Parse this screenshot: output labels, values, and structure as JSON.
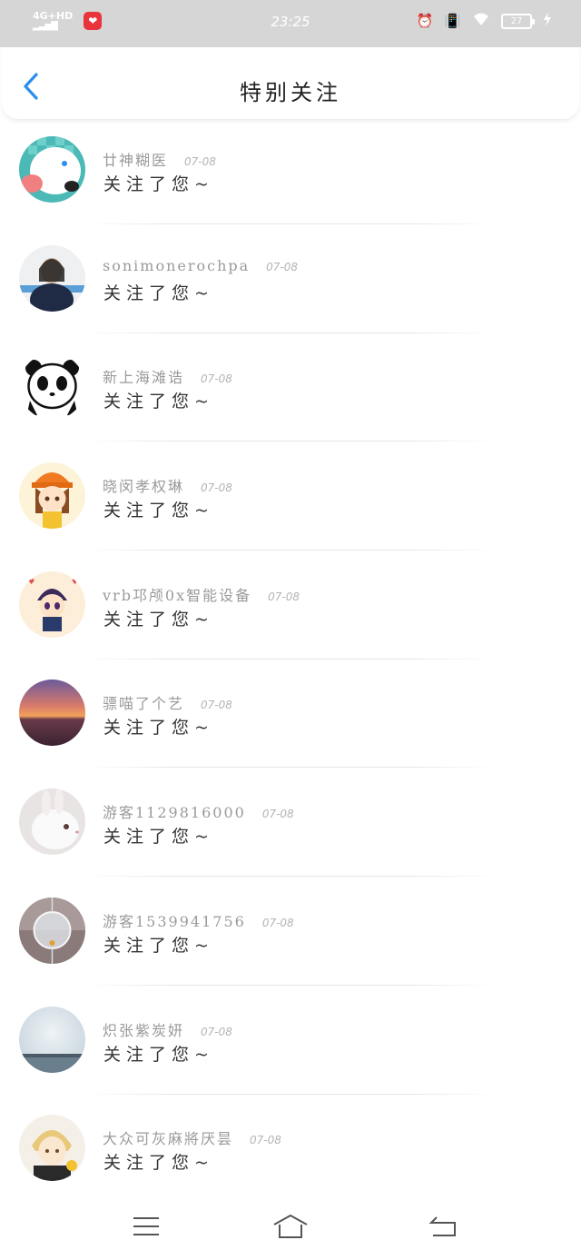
{
  "status_bar": {
    "network": "4G+HD",
    "signal_icon": "signal-bars-icon",
    "app_icon": "app-notification-icon",
    "time": "23:25",
    "alarm_icon": "alarm-icon",
    "vibrate_icon": "vibrate-icon",
    "wifi_icon": "wifi-icon",
    "battery_level": "27",
    "charging_icon": "charging-icon"
  },
  "header": {
    "title": "特别关注",
    "back_icon": "chevron-left-icon",
    "accent_color": "#2a8ef0"
  },
  "list": {
    "items": [
      {
        "name": "廿神糊医",
        "date": "07-08",
        "message": "关注了您~",
        "avatar": "cartoon-cat"
      },
      {
        "name": "sonimonerochpa",
        "date": "07-08",
        "message": "关注了您~",
        "avatar": "girl-photo"
      },
      {
        "name": "新上海滩诰",
        "date": "07-08",
        "message": "关注了您~",
        "avatar": "panda"
      },
      {
        "name": "晓闵孝权琳",
        "date": "07-08",
        "message": "关注了您~",
        "avatar": "girl-orange-hat"
      },
      {
        "name": "vrb邛颅0x智能设备",
        "date": "07-08",
        "message": "关注了您~",
        "avatar": "boy-cartoon"
      },
      {
        "name": "骠喵了个艺",
        "date": "07-08",
        "message": "关注了您~",
        "avatar": "sunset"
      },
      {
        "name": "游客1129816000",
        "date": "07-08",
        "message": "关注了您~",
        "avatar": "rabbit"
      },
      {
        "name": "游客1539941756",
        "date": "07-08",
        "message": "关注了您~",
        "avatar": "wind-chime"
      },
      {
        "name": "炽张紫炭妍",
        "date": "07-08",
        "message": "关注了您~",
        "avatar": "moon"
      },
      {
        "name": "大众可灰麻將厌昙",
        "date": "07-08",
        "message": "关注了您~",
        "avatar": "anime-boy"
      }
    ]
  },
  "nav_bar": {
    "menu_icon": "menu-icon",
    "home_icon": "home-icon",
    "back_icon": "return-icon"
  }
}
